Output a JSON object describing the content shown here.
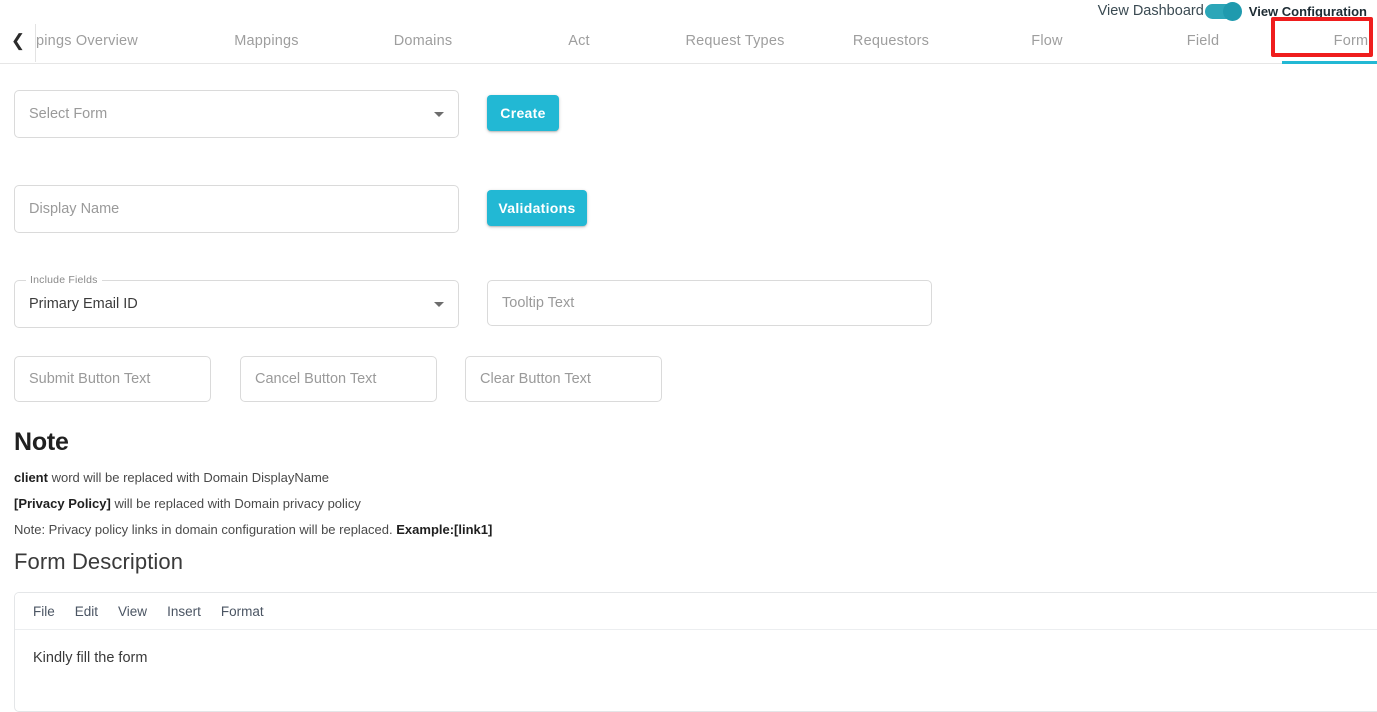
{
  "top_toggle": {
    "left_label": "View Dashboard",
    "right_label": "View Configuration",
    "state": "on",
    "accent_color": "#22b8d4"
  },
  "tabbar": {
    "back_icon": "chevron-left-icon",
    "active_tab": "Form",
    "highlight_color": "#ef1d1d",
    "tabs": [
      {
        "label": "pings Overview",
        "active": false
      },
      {
        "label": "Mappings",
        "active": false
      },
      {
        "label": "Domains",
        "active": false
      },
      {
        "label": "Act",
        "active": false
      },
      {
        "label": "Request Types",
        "active": false
      },
      {
        "label": "Requestors",
        "active": false
      },
      {
        "label": "Flow",
        "active": false
      },
      {
        "label": "Field",
        "active": false
      },
      {
        "label": "Form",
        "active": true
      }
    ]
  },
  "form": {
    "select_form": {
      "placeholder": "Select Form",
      "value": ""
    },
    "create_button": "Create",
    "display_name": {
      "placeholder": "Display Name",
      "value": ""
    },
    "validations_button": "Validations",
    "include_fields": {
      "label": "Include Fields",
      "value": "Primary Email ID"
    },
    "tooltip_text": {
      "placeholder": "Tooltip Text",
      "value": ""
    },
    "submit_button_text": {
      "placeholder": "Submit Button Text",
      "value": ""
    },
    "cancel_button_text": {
      "placeholder": "Cancel Button Text",
      "value": ""
    },
    "clear_button_text": {
      "placeholder": "Clear Button Text",
      "value": ""
    }
  },
  "note": {
    "title": "Note",
    "line1_bold": "client",
    "line1_rest": " word will be replaced with Domain DisplayName",
    "line2_bold": "[Privacy Policy]",
    "line2_rest": " will be replaced with Domain privacy policy",
    "line3_start": "Note: Privacy policy links in domain configuration will be replaced. ",
    "line3_bold": "Example:[link1]"
  },
  "form_description": {
    "title": "Form Description",
    "menu": [
      "File",
      "Edit",
      "View",
      "Insert",
      "Format"
    ],
    "content": "Kindly fill the form"
  }
}
